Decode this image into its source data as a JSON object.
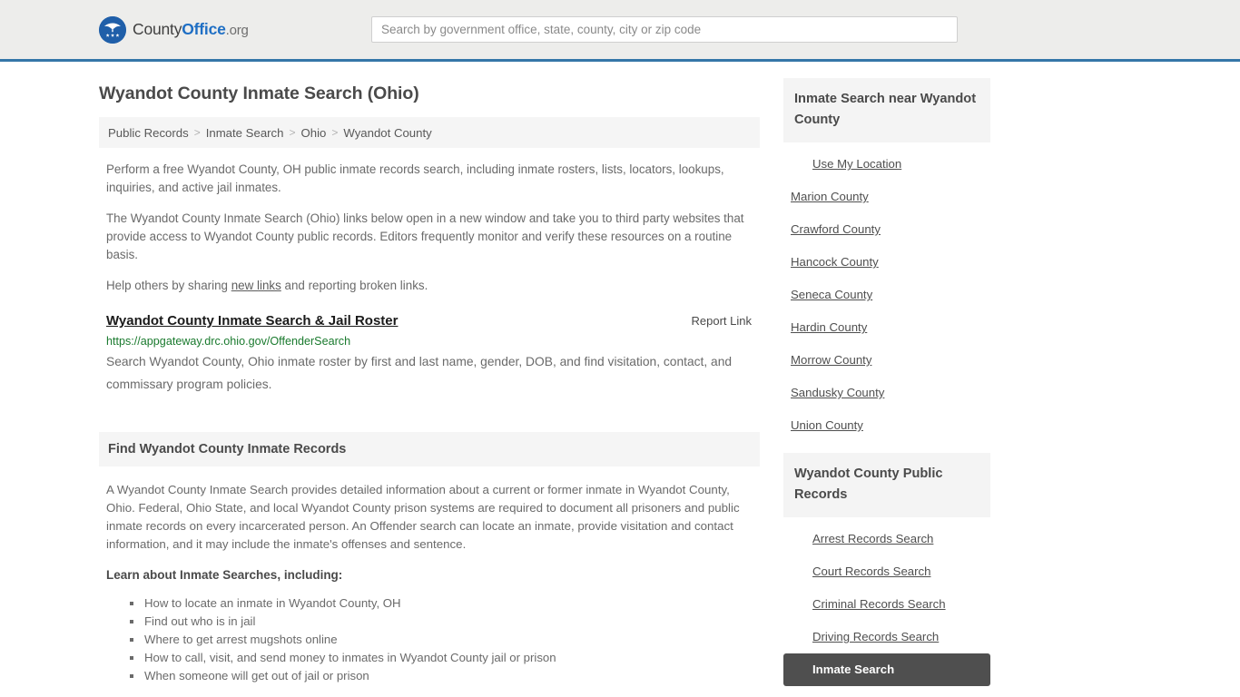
{
  "header": {
    "brand": {
      "part1": "County",
      "part2": "Office",
      "part3": ".org",
      "logo_icon": "eagle-shield-icon"
    },
    "search": {
      "placeholder": "Search by government office, state, county, city or zip code",
      "value": ""
    },
    "accent_color": "#3576a8",
    "background_color": "#ededeb"
  },
  "main": {
    "page_title": "Wyandot County Inmate Search (Ohio)",
    "breadcrumb": {
      "items": [
        "Public Records",
        "Inmate Search",
        "Ohio",
        "Wyandot County"
      ],
      "separator": ">"
    },
    "intro_paragraph_1": "Perform a free Wyandot County, OH public inmate records search, including inmate rosters, lists, locators, lookups, inquiries, and active jail inmates.",
    "intro_paragraph_2": "The Wyandot County Inmate Search (Ohio) links below open in a new window and take you to third party websites that provide access to Wyandot County public records. Editors frequently monitor and verify these resources on a routine basis.",
    "help_prefix": "Help others by sharing ",
    "help_link": "new links",
    "help_suffix": " and reporting broken links.",
    "listing": {
      "title": "Wyandot County Inmate Search & Jail Roster",
      "report_label": "Report Link",
      "url": "https://appgateway.drc.ohio.gov/OffenderSearch",
      "url_color": "#1a7a2e",
      "description": "Search Wyandot County, Ohio inmate roster by first and last name, gender, DOB, and find visitation, contact, and commissary program policies."
    },
    "section": {
      "heading": "Find Wyandot County Inmate Records",
      "body": "A Wyandot County Inmate Search provides detailed information about a current or former inmate in Wyandot County, Ohio. Federal, Ohio State, and local Wyandot County prison systems are required to document all prisoners and public inmate records on every incarcerated person. An Offender search can locate an inmate, provide visitation and contact information, and it may include the inmate's offenses and sentence.",
      "learn_title": "Learn about Inmate Searches, including:",
      "learn_items": [
        "How to locate an inmate in Wyandot County, OH",
        "Find out who is in jail",
        "Where to get arrest mugshots online",
        "How to call, visit, and send money to inmates in Wyandot County jail or prison",
        "When someone will get out of jail or prison"
      ]
    }
  },
  "sidebar": {
    "nearby": {
      "heading": "Inmate Search near Wyandot County",
      "items": [
        {
          "label": "Use My Location",
          "indented": true,
          "active": false
        },
        {
          "label": "Marion County",
          "indented": false,
          "active": false
        },
        {
          "label": "Crawford County",
          "indented": false,
          "active": false
        },
        {
          "label": "Hancock County",
          "indented": false,
          "active": false
        },
        {
          "label": "Seneca County",
          "indented": false,
          "active": false
        },
        {
          "label": "Hardin County",
          "indented": false,
          "active": false
        },
        {
          "label": "Morrow County",
          "indented": false,
          "active": false
        },
        {
          "label": "Sandusky County",
          "indented": false,
          "active": false
        },
        {
          "label": "Union County",
          "indented": false,
          "active": false
        }
      ]
    },
    "public_records": {
      "heading": "Wyandot County Public Records",
      "items": [
        {
          "label": "Arrest Records Search",
          "indented": true,
          "active": false
        },
        {
          "label": "Court Records Search",
          "indented": true,
          "active": false
        },
        {
          "label": "Criminal Records Search",
          "indented": true,
          "active": false
        },
        {
          "label": "Driving Records Search",
          "indented": true,
          "active": false
        },
        {
          "label": "Inmate Search",
          "indented": true,
          "active": true
        }
      ],
      "active_background": "#4f4f4f"
    }
  }
}
